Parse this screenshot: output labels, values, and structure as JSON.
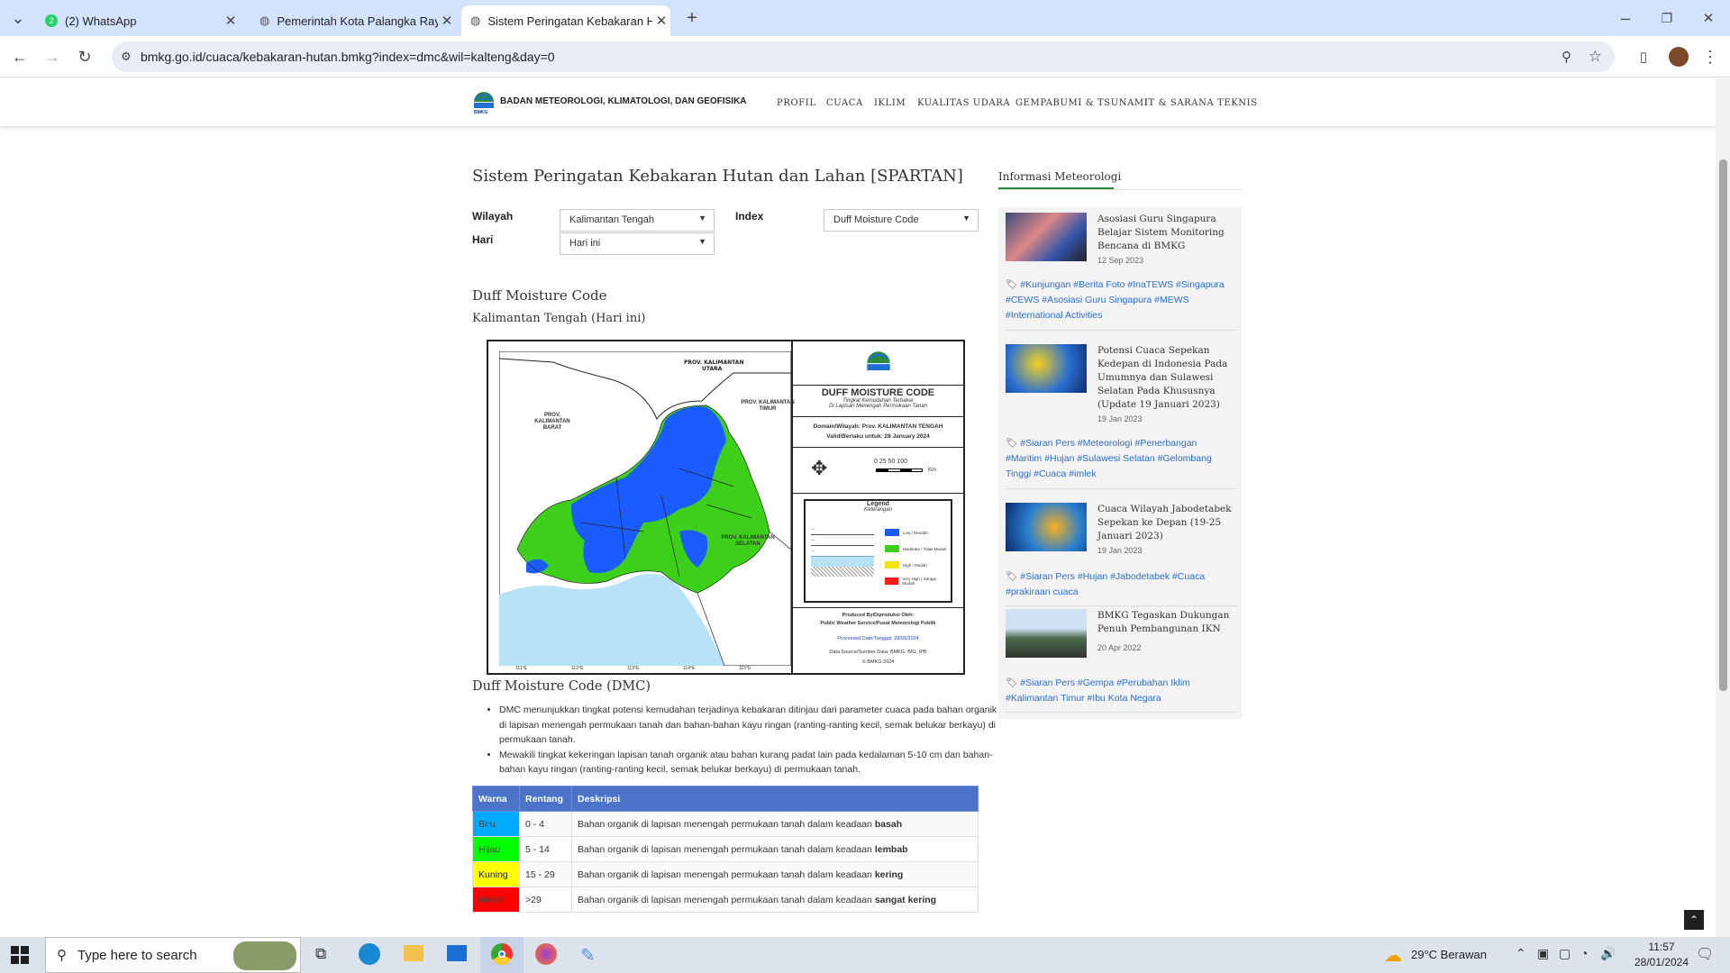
{
  "browser": {
    "tabs": [
      {
        "label": "(2) WhatsApp",
        "icon": "whatsapp-icon"
      },
      {
        "label": "Pemerintah Kota Palangka Raya",
        "icon": "globe-icon"
      },
      {
        "label": "Sistem Peringatan Kebakaran Hutan",
        "icon": "globe-icon",
        "active": true
      }
    ],
    "url": "bmkg.go.id/cuaca/kebakaran-hutan.bmkg?index=dmc&wil=kalteng&day=0"
  },
  "site": {
    "org": "BADAN METEOROLOGI, KLIMATOLOGI, DAN GEOFISIKA",
    "logo_text": "BMKG",
    "nav": [
      "PROFIL",
      "CUACA",
      "IKLIM",
      "KUALITAS UDARA",
      "GEMPABUMI & TSUNAMI",
      "IT & SARANA TEKNIS"
    ]
  },
  "main": {
    "title": "Sistem Peringatan Kebakaran Hutan dan Lahan [SPARTAN]",
    "wilayah_label": "Wilayah",
    "wilayah_value": "Kalimantan Tengah",
    "hari_label": "Hari",
    "hari_value": "Hari ini",
    "index_label": "Index",
    "index_value": "Duff Moisture Code",
    "section_title": "Duff Moisture Code",
    "section_subtitle": "Kalimantan Tengah (Hari ini)",
    "map": {
      "neighbors": [
        "PROV. KALIMANTAN UTARA",
        "PROV. KALIMANTAN BARAT",
        "PROV. KALIMANTAN TIMUR",
        "PROV. KALIMANTAN SELATAN"
      ],
      "legend_title": "DUFF MOISTURE CODE",
      "legend_sub1": "Tingkat Kemudahan Terbakar",
      "legend_sub2": "Di Lapisan Menengah Permukaan Tanah",
      "domain": "Domain/Wilayah: Prov. KALIMANTAN TENGAH",
      "valid": "Valid/Berlaku untuk: 28 January 2024",
      "scale": "0  25 50     100",
      "scale_unit": "Km",
      "legend_head": "Legend",
      "legend_head2": "Keterangan",
      "classes": [
        {
          "label": "Low / Rendah",
          "color": "#1a5cff"
        },
        {
          "label": "Moderate / Tidak Mudah",
          "color": "#3ecf1a"
        },
        {
          "label": "High / Mudah",
          "color": "#f5e600"
        },
        {
          "label": "Very High / Sangat Mudah",
          "color": "#ff1a1a"
        }
      ],
      "produced": "Produced By/Diproduksi Oleh:",
      "producer": "Public Weather Service/Pusat Meteorologi Publik",
      "processed": "Processed Date/Tanggal: 28/01/2024",
      "source": "Data Source/Sumber Data: BMKG, BIG, IPB",
      "copyright": "© BMKG 2024",
      "lon_ticks": [
        "111°E",
        "112°E",
        "113°E",
        "114°E",
        "115°E"
      ]
    },
    "desc_title": "Duff Moisture Code (DMC)",
    "bullets": [
      "DMC menunjukkan tingkat potensi kemudahan terjadinya kebakaran ditinjau dari parameter cuaca pada bahan organik di lapisan menengah permukaan tanah dan bahan-bahan kayu ringan (ranting-ranting kecil, semak belukar berkayu) di permukaan tanah.",
      "Mewakili tingkat kekeringan lapisan tanah organik atau bahan kurang padat lain pada kedalaman 5-10 cm dan bahan-bahan kayu ringan (ranting-ranting kecil, semak belukar berkayu) di permukaan tanah."
    ],
    "table": {
      "headers": [
        "Warna",
        "Rentang",
        "Deskripsi"
      ],
      "desc_prefix": "Bahan organik di lapisan menengah permukaan tanah dalam keadaan",
      "rows": [
        {
          "warna": "Biru",
          "color": "#00aaff",
          "rentang": "0 - 4",
          "status": "basah"
        },
        {
          "warna": "Hijau",
          "color": "#00ff00",
          "rentang": "5 - 14",
          "status": "lembab"
        },
        {
          "warna": "Kuning",
          "color": "#ffff00",
          "rentang": "15 - 29",
          "status": "kering"
        },
        {
          "warna": "Merah",
          "color": "#ff0000",
          "rentang": ">29",
          "status": "sangat kering"
        }
      ]
    }
  },
  "side": {
    "heading": "Informasi Meteorologi",
    "items": [
      {
        "title": "Asosiasi Guru Singapura Belajar Sistem Monitoring Bencana di BMKG",
        "date": "12 Sep 2023",
        "tags": "#Kunjungan #Berita Foto #InaTEWS #Singapura #CEWS #Asosiasi Guru Singapura #MEWS #International Activities"
      },
      {
        "title": "Potensi Cuaca Sepekan Kedepan di Indonesia Pada Umumnya dan Sulawesi Selatan Pada Khususnya (Update 19 Januari 2023)",
        "date": "19 Jan 2023",
        "tags": "#Siaran Pers #Meteorologi #Penerbangan #Maritim #Hujan #Sulawesi Selatan #Gelombang Tinggi #Cuaca #imlek"
      },
      {
        "title": "Cuaca Wilayah Jabodetabek Sepekan ke Depan (19-25 Januari 2023)",
        "date": "19 Jan 2023",
        "tags": "#Siaran Pers #Hujan #Jabodetabek #Cuaca #prakiraan cuaca"
      },
      {
        "title": "BMKG Tegaskan Dukungan Penuh Pembangunan IKN",
        "date": "20 Apr 2022",
        "tags": "#Siaran Pers #Gempa #Perubahan Iklim #Kalimantan Timur #Ibu Kota Negara"
      }
    ]
  },
  "taskbar": {
    "search_placeholder": "Type here to search",
    "weather": "29°C  Berawan",
    "time": "11:57",
    "date": "28/01/2024"
  }
}
